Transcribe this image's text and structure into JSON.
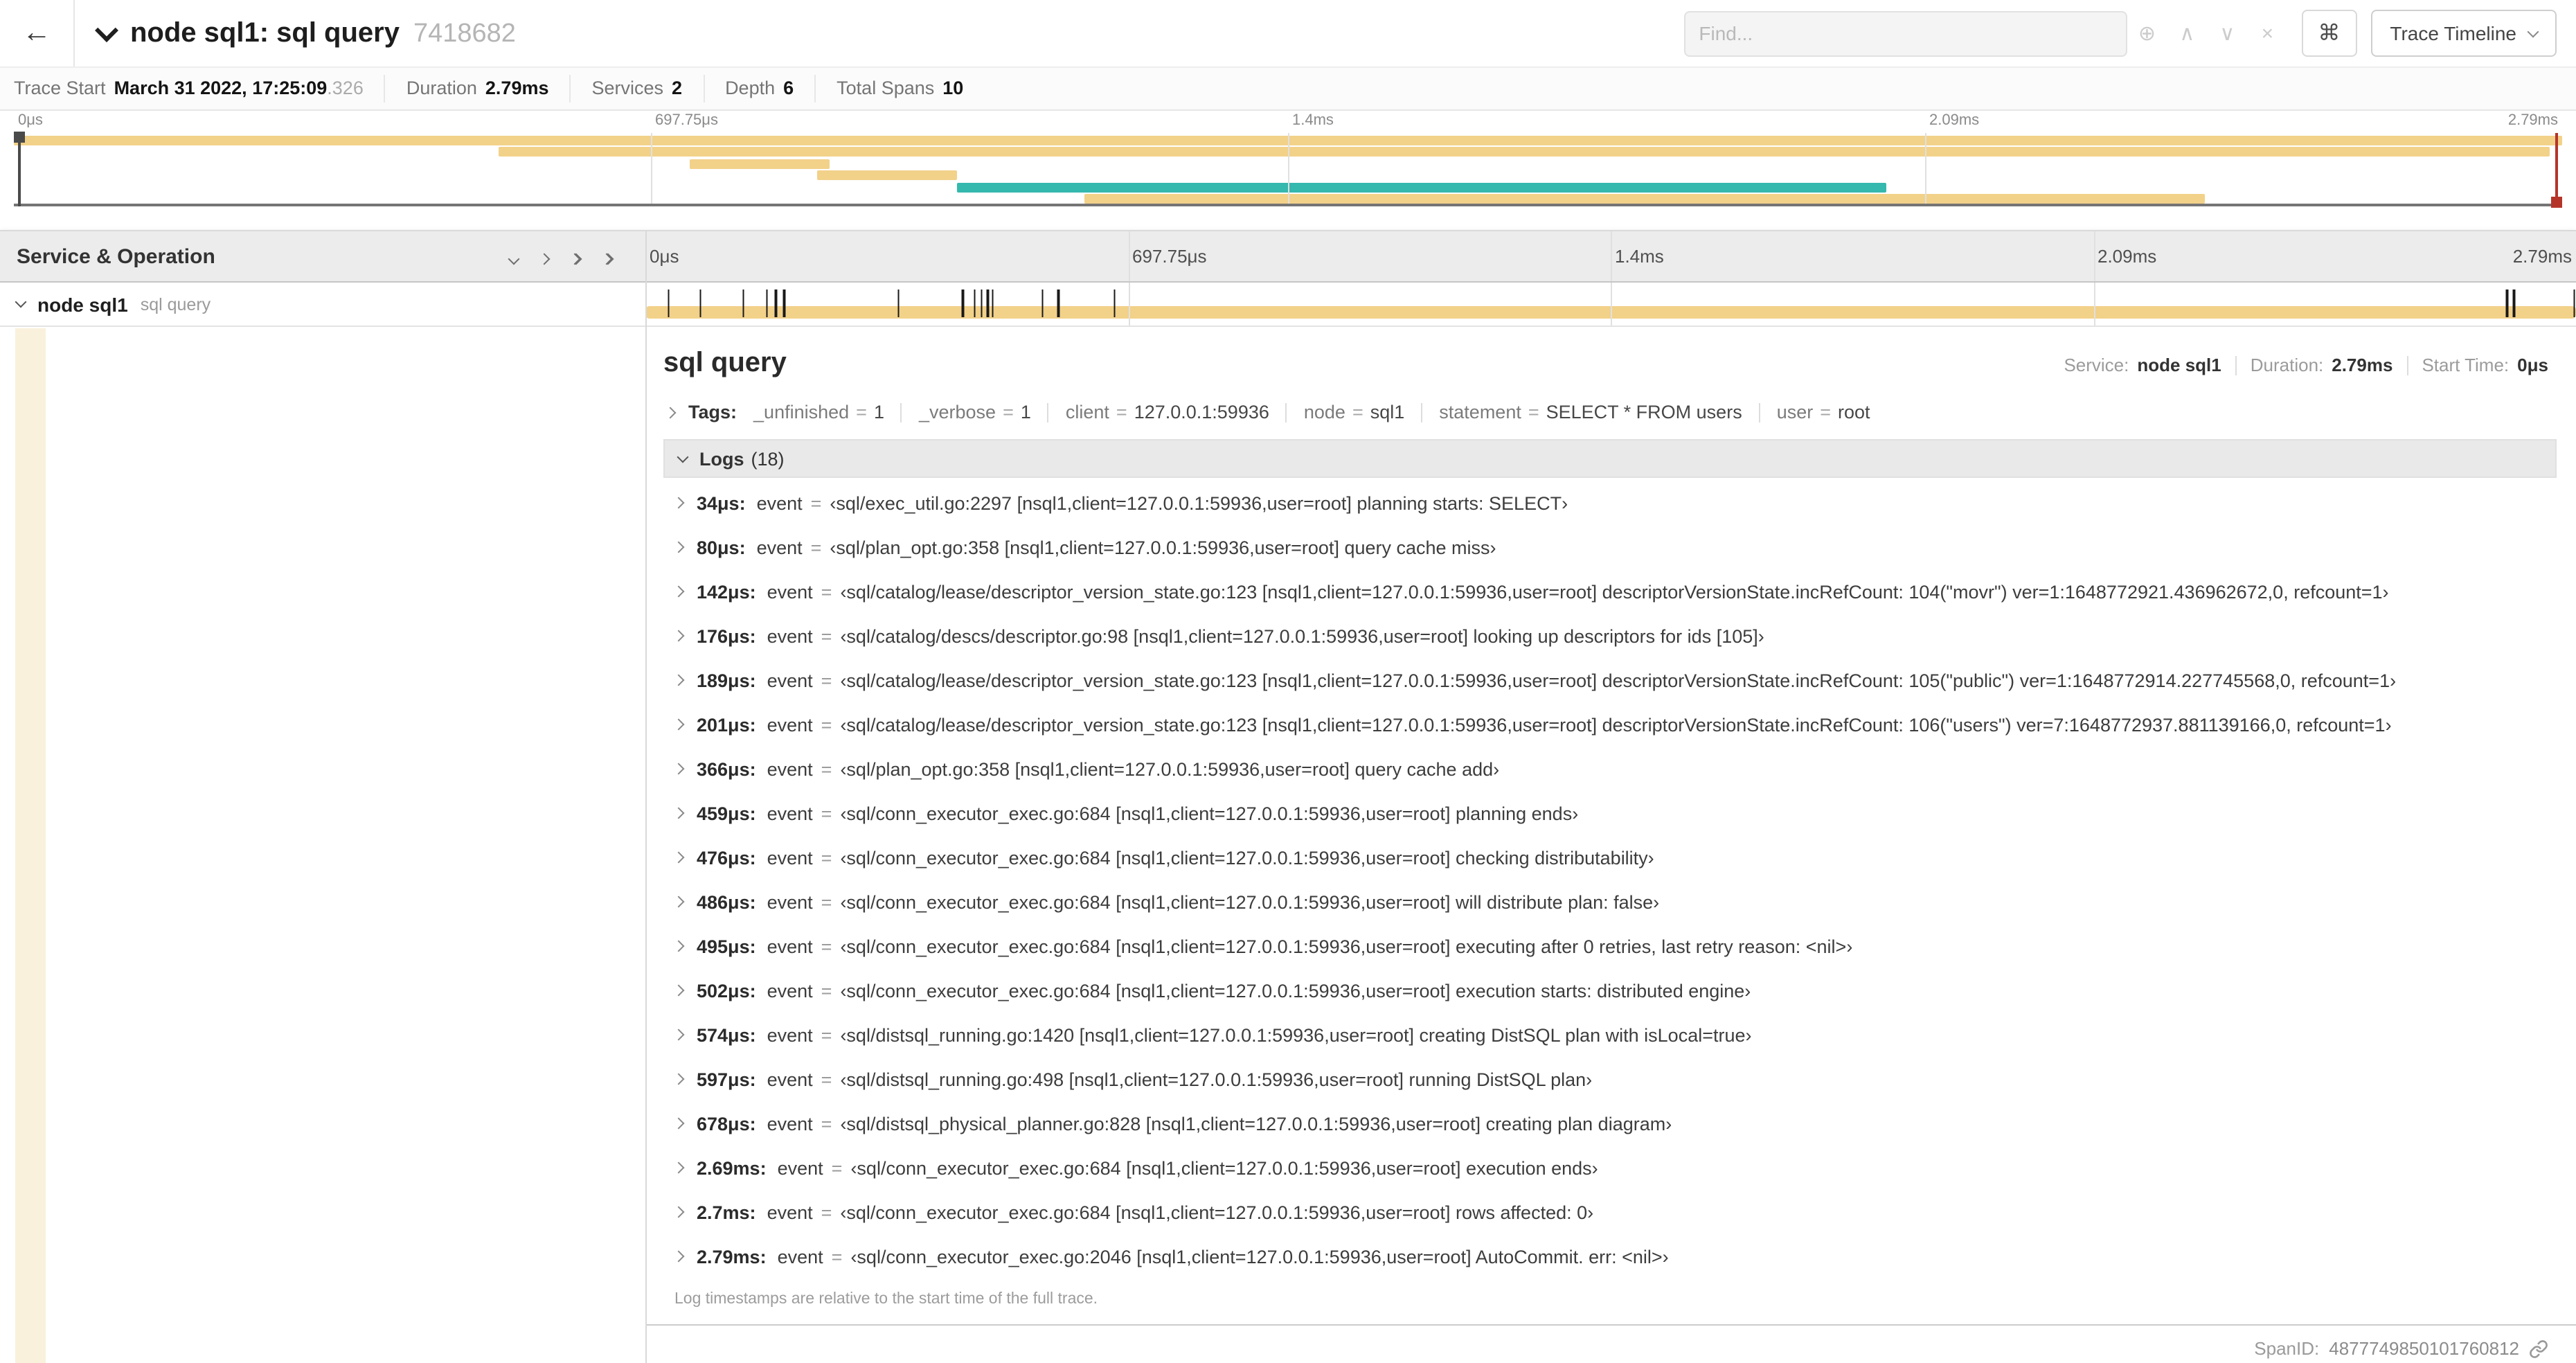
{
  "colors": {
    "span_bar": "#f2d189",
    "span_bar_light": "#faf1dc",
    "teal_bar": "#35b8ae",
    "scrubber_left": "#4a4a4a",
    "scrubber_right": "#b5342a"
  },
  "header": {
    "back_icon": "←",
    "title": "node sql1: sql query",
    "trace_id": "7418682",
    "find_placeholder": "Find...",
    "find_icons": [
      {
        "name": "circled-plus",
        "glyph": "⊕"
      },
      {
        "name": "chevron-up",
        "glyph": "∧"
      },
      {
        "name": "chevron-down",
        "glyph": "∨"
      },
      {
        "name": "close",
        "glyph": "×"
      }
    ],
    "keyboard_icon": "⌘",
    "view_selector": "Trace Timeline"
  },
  "summary": {
    "items": [
      {
        "label": "Trace Start",
        "value": "March 31 2022, 17:25:09",
        "suffix": ".326"
      },
      {
        "label": "Duration",
        "value": "2.79ms"
      },
      {
        "label": "Services",
        "value": "2"
      },
      {
        "label": "Depth",
        "value": "6"
      },
      {
        "label": "Total Spans",
        "value": "10"
      }
    ]
  },
  "timeline": {
    "duration_us": 2790,
    "header_label": "Service & Operation",
    "ruler_labels": [
      {
        "text": "0μs",
        "pct": 0
      },
      {
        "text": "697.75μs",
        "pct": 25
      },
      {
        "text": "1.4ms",
        "pct": 50
      },
      {
        "text": "2.09ms",
        "pct": 75
      },
      {
        "text": "2.79ms",
        "pct": 100,
        "align": "right"
      }
    ],
    "minimap_bars": [
      {
        "row": 0,
        "left_pct": 0,
        "width_pct": 100,
        "color": "span_bar"
      },
      {
        "row": 1,
        "left_pct": 19,
        "width_pct": 80.5,
        "color": "span_bar"
      },
      {
        "row": 2,
        "left_pct": 26.5,
        "width_pct": 5.5,
        "color": "span_bar"
      },
      {
        "row": 3,
        "left_pct": 31.5,
        "width_pct": 5.5,
        "color": "span_bar"
      },
      {
        "row": 4,
        "left_pct": 37,
        "width_pct": 36.5,
        "color": "teal_bar"
      },
      {
        "row": 5,
        "left_pct": 42,
        "width_pct": 44,
        "color": "span_bar"
      }
    ],
    "scrubbers": [
      {
        "side": "left",
        "pos_pct": 0.15,
        "color": "#4a4a4a",
        "handle": "top"
      },
      {
        "side": "right",
        "pos_pct": 99.75,
        "color": "#b5342a",
        "handle": "bottom"
      }
    ]
  },
  "span_row": {
    "service": "node sql1",
    "operation": "sql query"
  },
  "detail": {
    "title": "sql query",
    "meta": [
      {
        "label": "Service:",
        "value": "node sql1"
      },
      {
        "label": "Duration:",
        "value": "2.79ms"
      },
      {
        "label": "Start Time:",
        "value": "0μs"
      }
    ],
    "tags_label": "Tags:",
    "tags": [
      {
        "key": "_unfinished",
        "value": "1"
      },
      {
        "key": "_verbose",
        "value": "1"
      },
      {
        "key": "client",
        "value": "127.0.0.1:59936"
      },
      {
        "key": "node",
        "value": "sql1"
      },
      {
        "key": "statement",
        "value": "SELECT * FROM users"
      },
      {
        "key": "user",
        "value": "root"
      }
    ],
    "logs_label": "Logs",
    "logs_count": "(18)",
    "log_field": "event",
    "logs": [
      {
        "time": "34μs:",
        "t_us": 34,
        "message": "‹sql/exec_util.go:2297 [nsql1,client=127.0.0.1:59936,user=root] planning starts: SELECT›"
      },
      {
        "time": "80μs:",
        "t_us": 80,
        "message": "‹sql/plan_opt.go:358 [nsql1,client=127.0.0.1:59936,user=root] query cache miss›"
      },
      {
        "time": "142μs:",
        "t_us": 142,
        "message": "‹sql/catalog/lease/descriptor_version_state.go:123 [nsql1,client=127.0.0.1:59936,user=root] descriptorVersionState.incRefCount: 104(\"movr\") ver=1:1648772921.436962672,0, refcount=1›"
      },
      {
        "time": "176μs:",
        "t_us": 176,
        "message": "‹sql/catalog/descs/descriptor.go:98 [nsql1,client=127.0.0.1:59936,user=root] looking up descriptors for ids [105]›"
      },
      {
        "time": "189μs:",
        "t_us": 189,
        "message": "‹sql/catalog/lease/descriptor_version_state.go:123 [nsql1,client=127.0.0.1:59936,user=root] descriptorVersionState.incRefCount: 105(\"public\") ver=1:1648772914.227745568,0, refcount=1›"
      },
      {
        "time": "201μs:",
        "t_us": 201,
        "message": "‹sql/catalog/lease/descriptor_version_state.go:123 [nsql1,client=127.0.0.1:59936,user=root] descriptorVersionState.incRefCount: 106(\"users\") ver=7:1648772937.881139166,0, refcount=1›"
      },
      {
        "time": "366μs:",
        "t_us": 366,
        "message": "‹sql/plan_opt.go:358 [nsql1,client=127.0.0.1:59936,user=root] query cache add›"
      },
      {
        "time": "459μs:",
        "t_us": 459,
        "message": "‹sql/conn_executor_exec.go:684 [nsql1,client=127.0.0.1:59936,user=root] planning ends›"
      },
      {
        "time": "476μs:",
        "t_us": 476,
        "message": "‹sql/conn_executor_exec.go:684 [nsql1,client=127.0.0.1:59936,user=root] checking distributability›"
      },
      {
        "time": "486μs:",
        "t_us": 486,
        "message": "‹sql/conn_executor_exec.go:684 [nsql1,client=127.0.0.1:59936,user=root] will distribute plan: false›"
      },
      {
        "time": "495μs:",
        "t_us": 495,
        "message": "‹sql/conn_executor_exec.go:684 [nsql1,client=127.0.0.1:59936,user=root] executing after 0 retries, last retry reason: <nil>›"
      },
      {
        "time": "502μs:",
        "t_us": 502,
        "message": "‹sql/conn_executor_exec.go:684 [nsql1,client=127.0.0.1:59936,user=root] execution starts: distributed engine›"
      },
      {
        "time": "574μs:",
        "t_us": 574,
        "message": "‹sql/distsql_running.go:1420 [nsql1,client=127.0.0.1:59936,user=root] creating DistSQL plan with isLocal=true›"
      },
      {
        "time": "597μs:",
        "t_us": 597,
        "message": "‹sql/distsql_running.go:498 [nsql1,client=127.0.0.1:59936,user=root] running DistSQL plan›"
      },
      {
        "time": "678μs:",
        "t_us": 678,
        "message": "‹sql/distsql_physical_planner.go:828 [nsql1,client=127.0.0.1:59936,user=root] creating plan diagram›"
      },
      {
        "time": "2.69ms:",
        "t_us": 2690,
        "message": "‹sql/conn_executor_exec.go:684 [nsql1,client=127.0.0.1:59936,user=root] execution ends›"
      },
      {
        "time": "2.7ms:",
        "t_us": 2700,
        "message": "‹sql/conn_executor_exec.go:684 [nsql1,client=127.0.0.1:59936,user=root] rows affected: 0›"
      },
      {
        "time": "2.79ms:",
        "t_us": 2790,
        "message": "‹sql/conn_executor_exec.go:2046 [nsql1,client=127.0.0.1:59936,user=root] AutoCommit. err: <nil>›"
      }
    ],
    "logs_note": "Log timestamps are relative to the start time of the full trace.",
    "span_id_label": "SpanID:",
    "span_id": "4877749850101760812"
  }
}
